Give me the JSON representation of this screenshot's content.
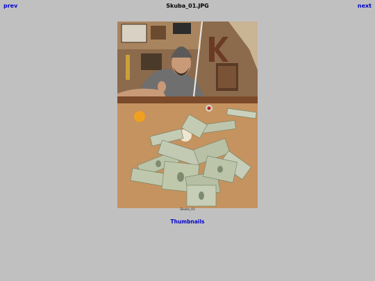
{
  "nav": {
    "prev_label": "prev",
    "next_label": "next"
  },
  "title": "Skuba_01.JPG",
  "photo": {
    "caption": "Skuba_01"
  },
  "thumbnails_label": "Thumbnails",
  "colors": {
    "background": "#c0c0c0",
    "link": "#0000cc",
    "text": "#000000"
  }
}
